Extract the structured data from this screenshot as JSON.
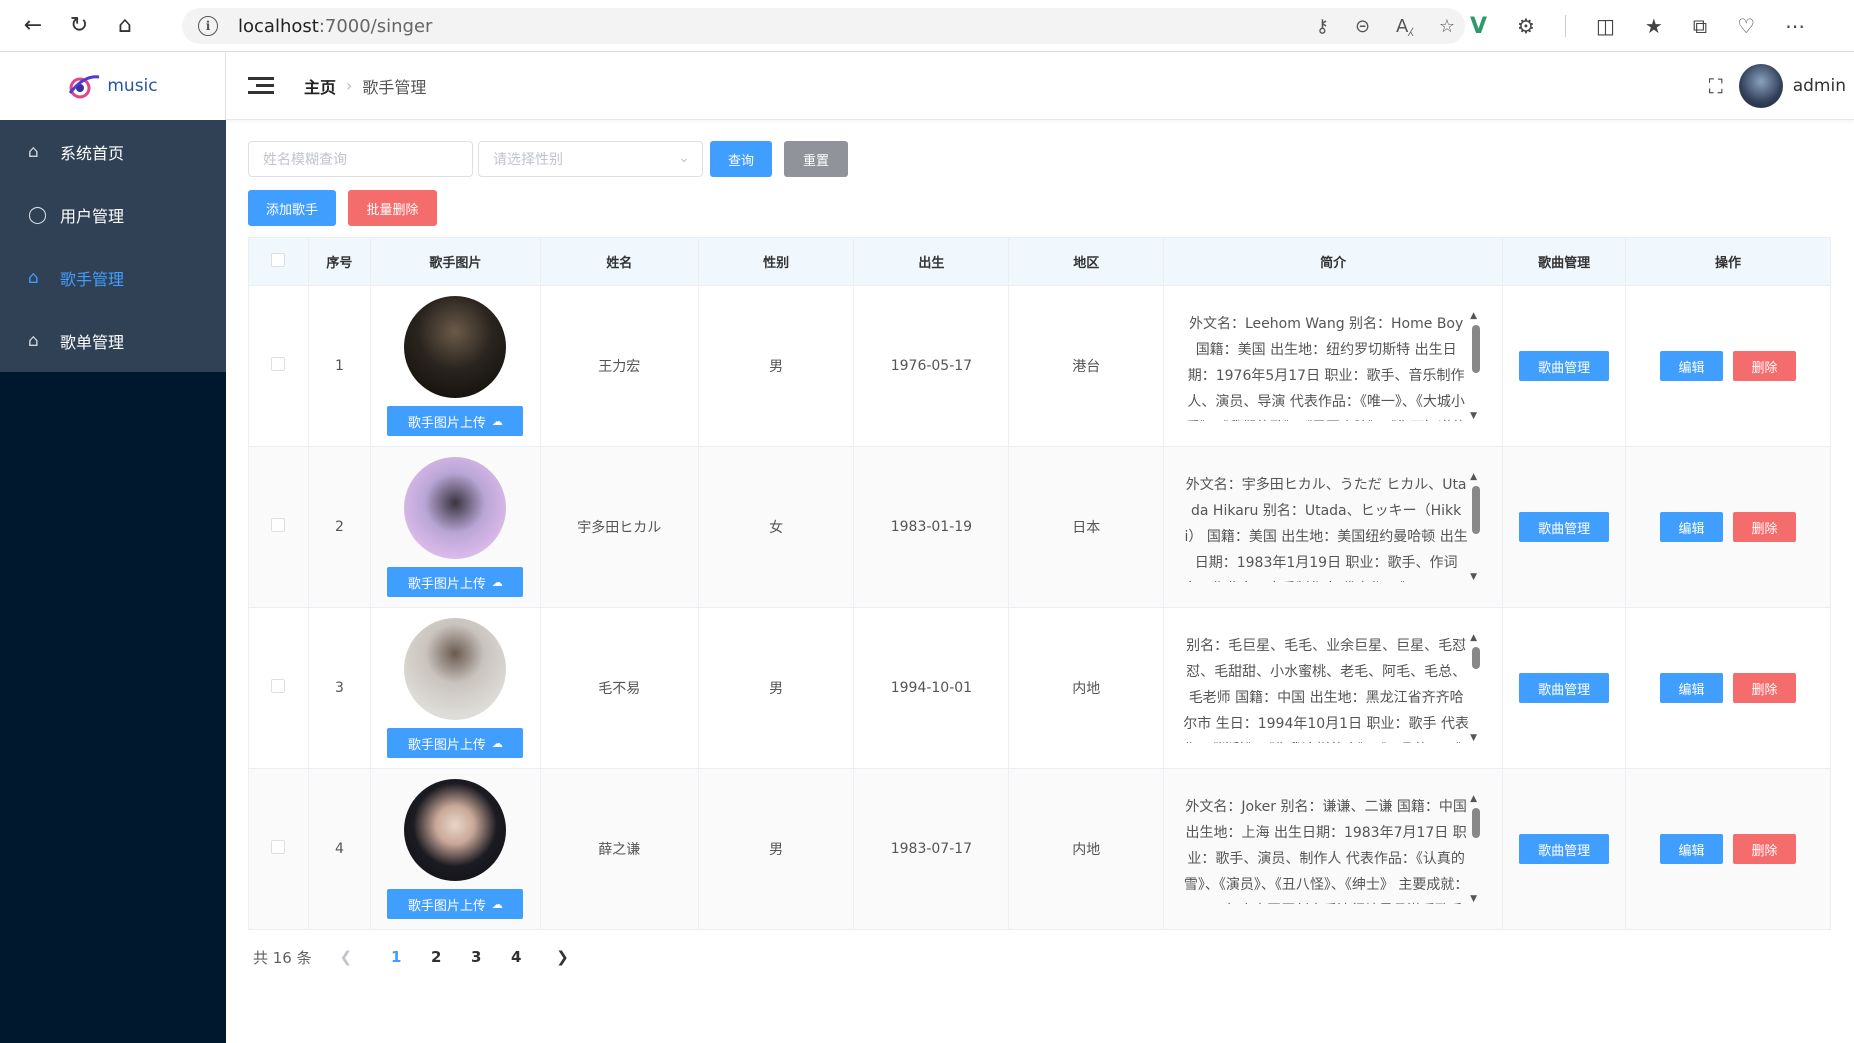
{
  "browser": {
    "url_host": "localhost",
    "url_rest": ":7000/singer"
  },
  "sidebar": {
    "logo_text": "music",
    "items": [
      {
        "label": "系统首页",
        "icon": "home-icon"
      },
      {
        "label": "用户管理",
        "icon": "user-icon"
      },
      {
        "label": "歌手管理",
        "icon": "home-icon",
        "active": true
      },
      {
        "label": "歌单管理",
        "icon": "home-icon"
      }
    ]
  },
  "header": {
    "breadcrumb_home": "主页",
    "breadcrumb_current": "歌手管理",
    "username": "admin"
  },
  "search": {
    "name_placeholder": "姓名模糊查询",
    "gender_placeholder": "请选择性别",
    "query_label": "查询",
    "reset_label": "重置"
  },
  "actions": {
    "add_label": "添加歌手",
    "batch_delete_label": "批量删除"
  },
  "table": {
    "columns": [
      "序号",
      "歌手图片",
      "姓名",
      "性别",
      "出生",
      "地区",
      "简介",
      "歌曲管理",
      "操作"
    ],
    "upload_label": "歌手图片上传",
    "manage_label": "歌曲管理",
    "edit_label": "编辑",
    "delete_label": "删除",
    "rows": [
      {
        "index": "1",
        "name": "王力宏",
        "gender": "男",
        "birth": "1976-05-17",
        "region": "港台",
        "intro": "外文名：Leehom Wang 别名：Home Boy 国籍：美国 出生地：纽约罗切斯特 出生日期：1976年5月17日 职业：歌手、音乐制作人、演员、导演 代表作品：《唯一》、《大城小爱》、《我们的歌》、《需要人陪》、《你不知道的事》"
      },
      {
        "index": "2",
        "name": "宇多田ヒカル",
        "gender": "女",
        "birth": "1983-01-19",
        "region": "日本",
        "intro": "外文名：宇多田ヒカル、うただ ヒカル、Utada Hikaru 别名：Utada、ヒッキー（Hikki） 国籍：美国 出生地：美国纽约曼哈顿 出生日期：1983年1月19日 职业：歌手、作词家、作曲家、音乐制作人 代表作：《Automatic》、《First Love》"
      },
      {
        "index": "3",
        "name": "毛不易",
        "gender": "男",
        "birth": "1994-10-01",
        "region": "内地",
        "intro": "别名：毛巨星、毛毛、业余巨星、巨星、毛怼怼、毛甜甜、小水蜜桃、老毛、阿毛、毛总、毛老师 国籍：中国 出生地：黑龙江省齐齐哈尔市 生日：1994年10月1日 职业：歌手 代表作：《消愁》、《像我这样的人》、《平凡的一天》"
      },
      {
        "index": "4",
        "name": "薛之谦",
        "gender": "男",
        "birth": "1983-07-17",
        "region": "内地",
        "intro": "外文名：Joker 别名：谦谦、二谦 国籍：中国 出生地：上海 出生日期：1983年7月17日 职业：歌手、演员、制作人 代表作品：《认真的雪》、《演员》、《丑八怪》、《绅士》 主要成就：2009年度中国原创音乐流行榜最具潜质歌手大奖、2016年度十大金曲"
      }
    ]
  },
  "pagination": {
    "total_text": "共 16 条",
    "pages": [
      "1",
      "2",
      "3",
      "4"
    ],
    "current": "1"
  }
}
